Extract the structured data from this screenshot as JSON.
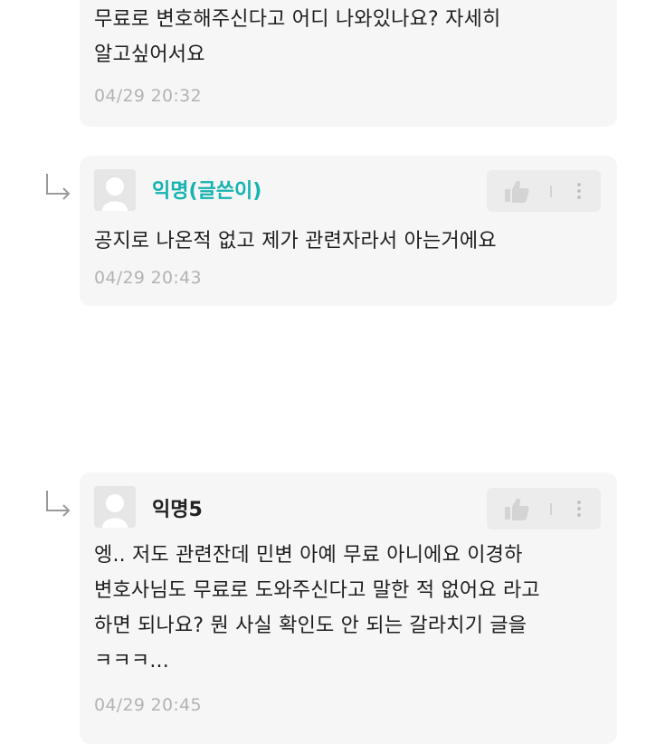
{
  "comments": [
    {
      "text_line1": "무료로 변호해주신다고 어디 나와있나요? 자세히",
      "text_line2": "알고싶어서요",
      "time": "04/29 20:32"
    },
    {
      "author": "익명(글쓴이)",
      "text": "공지로 나온적 없고 제가 관련자라서 아는거에요",
      "time": "04/29 20:43",
      "is_reply": true,
      "is_writer": true
    },
    {
      "author": "익명5",
      "text_line1": "엥.. 저도 관련잔데 민변 아예 무료 아니에요 이경하",
      "text_line2": "변호사님도 무료로 도와주신다고 말한 적 없어요 라고",
      "text_line3": "하면 되나요? 뭔 사실 확인도 안 되는 갈라치기 글을",
      "text_line4": "ㅋㅋㅋ...",
      "time": "04/29 20:45",
      "is_reply": true,
      "is_writer": false
    }
  ],
  "icons": {
    "reply_arrow": "reply-arrow-icon",
    "avatar": "anonymous-avatar-icon",
    "like": "thumbs-up-icon",
    "more": "more-vertical-icon"
  },
  "colors": {
    "writer_accent": "#16b3b0",
    "card_background": "#f6f6f6",
    "timestamp": "#b3b3b3"
  }
}
